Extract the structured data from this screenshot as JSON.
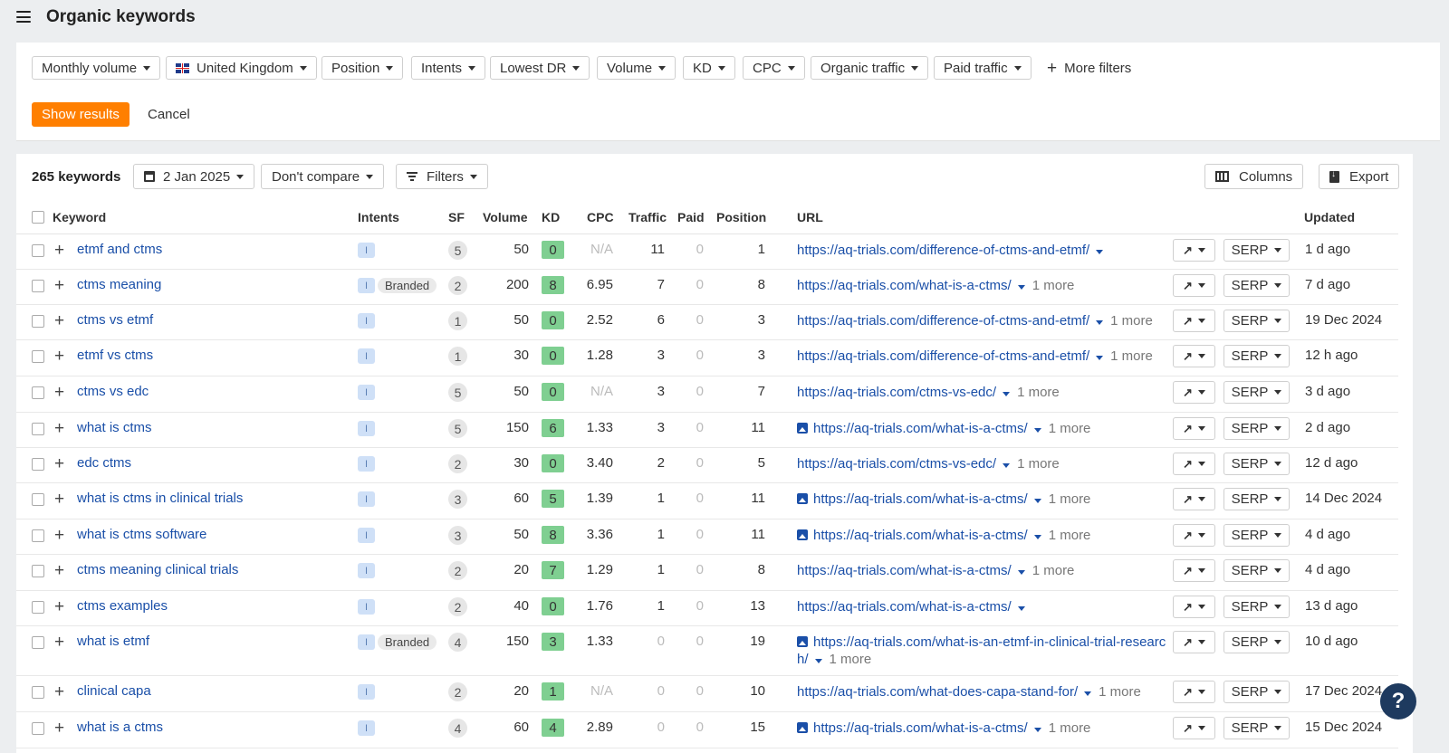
{
  "header": {
    "title": "Organic keywords",
    "menu_icon": "hamburger-icon"
  },
  "filters": {
    "buttons": [
      "Monthly volume",
      "United Kingdom",
      "Position",
      "Intents",
      "Lowest DR",
      "Volume",
      "KD",
      "CPC",
      "Organic traffic",
      "Paid traffic"
    ],
    "more_filters": "More filters",
    "show_results": "Show results",
    "cancel": "Cancel"
  },
  "toolbar": {
    "count": "265 keywords",
    "date": "2 Jan 2025",
    "compare": "Don't compare",
    "filters": "Filters",
    "columns": "Columns",
    "export": "Export"
  },
  "table": {
    "columns": [
      "Keyword",
      "Intents",
      "SF",
      "Volume",
      "KD",
      "CPC",
      "Traffic",
      "Paid",
      "Position",
      "URL",
      "Updated"
    ],
    "serp_label": "SERP",
    "rows": [
      {
        "keyword": "etmf and ctms",
        "intent": "I",
        "branded": "",
        "sf": "5",
        "volume": "50",
        "kd": "0",
        "cpc": "N/A",
        "traffic": "11",
        "paid": "0",
        "position": "1",
        "url": "https://aq-trials.com/difference-of-ctms-and-etmf/",
        "url2": "",
        "more": "",
        "img": false,
        "updated": "1 d ago"
      },
      {
        "keyword": "ctms meaning",
        "intent": "I",
        "branded": "Branded",
        "sf": "2",
        "volume": "200",
        "kd": "8",
        "cpc": "6.95",
        "traffic": "7",
        "paid": "0",
        "position": "8",
        "url": "https://aq-trials.com/what-is-a-ctms/",
        "url2": "",
        "more": "1 more",
        "img": false,
        "updated": "7 d ago"
      },
      {
        "keyword": "ctms vs etmf",
        "intent": "I",
        "branded": "",
        "sf": "1",
        "volume": "50",
        "kd": "0",
        "cpc": "2.52",
        "traffic": "6",
        "paid": "0",
        "position": "3",
        "url": "https://aq-trials.com/difference-of-ctms-and-etmf/",
        "url2": "",
        "more": "1 more",
        "img": false,
        "updated": "19 Dec 2024"
      },
      {
        "keyword": "etmf vs ctms",
        "intent": "I",
        "branded": "",
        "sf": "1",
        "volume": "30",
        "kd": "0",
        "cpc": "1.28",
        "traffic": "3",
        "paid": "0",
        "position": "3",
        "url": "https://aq-trials.com/difference-of-ctms-and-etmf/",
        "url2": "",
        "more": "1 more",
        "img": false,
        "updated": "12 h ago"
      },
      {
        "keyword": "ctms vs edc",
        "intent": "I",
        "branded": "",
        "sf": "5",
        "volume": "50",
        "kd": "0",
        "cpc": "N/A",
        "traffic": "3",
        "paid": "0",
        "position": "7",
        "url": "https://aq-trials.com/ctms-vs-edc/",
        "url2": "",
        "more": "1 more",
        "img": false,
        "updated": "3 d ago"
      },
      {
        "keyword": "what is ctms",
        "intent": "I",
        "branded": "",
        "sf": "5",
        "volume": "150",
        "kd": "6",
        "cpc": "1.33",
        "traffic": "3",
        "paid": "0",
        "position": "11",
        "url": "https://aq-trials.com/what-is-a-ctms/",
        "url2": "",
        "more": "1 more",
        "img": true,
        "updated": "2 d ago"
      },
      {
        "keyword": "edc ctms",
        "intent": "I",
        "branded": "",
        "sf": "2",
        "volume": "30",
        "kd": "0",
        "cpc": "3.40",
        "traffic": "2",
        "paid": "0",
        "position": "5",
        "url": "https://aq-trials.com/ctms-vs-edc/",
        "url2": "",
        "more": "1 more",
        "img": false,
        "updated": "12 d ago"
      },
      {
        "keyword": "what is ctms in clinical trials",
        "intent": "I",
        "branded": "",
        "sf": "3",
        "volume": "60",
        "kd": "5",
        "cpc": "1.39",
        "traffic": "1",
        "paid": "0",
        "position": "11",
        "url": "https://aq-trials.com/what-is-a-ctms/",
        "url2": "",
        "more": "1 more",
        "img": true,
        "updated": "14 Dec 2024"
      },
      {
        "keyword": "what is ctms software",
        "intent": "I",
        "branded": "",
        "sf": "3",
        "volume": "50",
        "kd": "8",
        "cpc": "3.36",
        "traffic": "1",
        "paid": "0",
        "position": "11",
        "url": "https://aq-trials.com/what-is-a-ctms/",
        "url2": "",
        "more": "1 more",
        "img": true,
        "updated": "4 d ago"
      },
      {
        "keyword": "ctms meaning clinical trials",
        "intent": "I",
        "branded": "",
        "sf": "2",
        "volume": "20",
        "kd": "7",
        "cpc": "1.29",
        "traffic": "1",
        "paid": "0",
        "position": "8",
        "url": "https://aq-trials.com/what-is-a-ctms/",
        "url2": "",
        "more": "1 more",
        "img": false,
        "updated": "4 d ago"
      },
      {
        "keyword": "ctms examples",
        "intent": "I",
        "branded": "",
        "sf": "2",
        "volume": "40",
        "kd": "0",
        "cpc": "1.76",
        "traffic": "1",
        "paid": "0",
        "position": "13",
        "url": "https://aq-trials.com/what-is-a-ctms/",
        "url2": "",
        "more": "",
        "img": false,
        "updated": "13 d ago"
      },
      {
        "keyword": "what is etmf",
        "intent": "I",
        "branded": "Branded",
        "sf": "4",
        "volume": "150",
        "kd": "3",
        "cpc": "1.33",
        "traffic": "0",
        "paid": "0",
        "position": "19",
        "url": "https://aq-trials.com/what-is-an-etmf-in-clinical-trial-researc",
        "url2": "h/",
        "more": "1 more",
        "img": true,
        "updated": "10 d ago"
      },
      {
        "keyword": "clinical capa",
        "intent": "I",
        "branded": "",
        "sf": "2",
        "volume": "20",
        "kd": "1",
        "cpc": "N/A",
        "traffic": "0",
        "paid": "0",
        "position": "10",
        "url": "https://aq-trials.com/what-does-capa-stand-for/",
        "url2": "",
        "more": "1 more",
        "img": false,
        "updated": "17 Dec 2024"
      },
      {
        "keyword": "what is a ctms",
        "intent": "I",
        "branded": "",
        "sf": "4",
        "volume": "60",
        "kd": "4",
        "cpc": "2.89",
        "traffic": "0",
        "paid": "0",
        "position": "15",
        "url": "https://aq-trials.com/what-is-a-ctms/",
        "url2": "",
        "more": "1 more",
        "img": true,
        "updated": "15 Dec 2024"
      }
    ]
  },
  "colors": {
    "accent": "#ff7f00",
    "link": "#1a4fa8",
    "kd_low": "#78c98c",
    "kd_mid": "#a8d8a0",
    "help": "#1e3a5f"
  },
  "help_label": "?"
}
